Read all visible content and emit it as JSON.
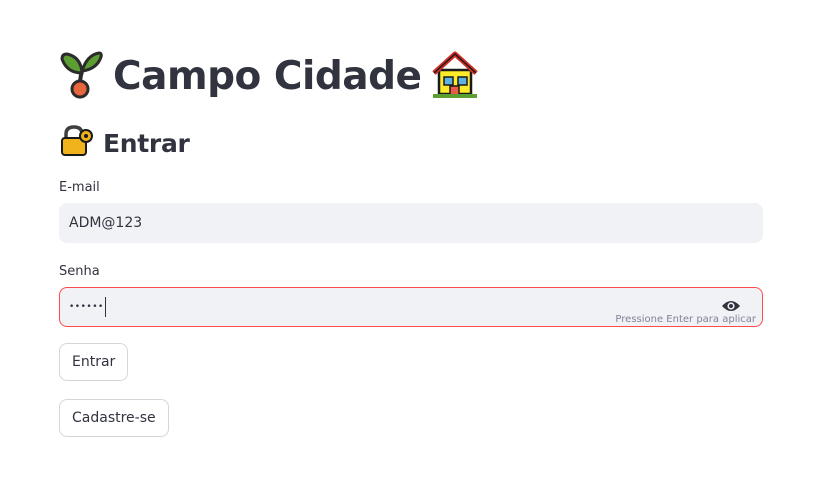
{
  "header": {
    "title": "Campo Cidade",
    "title_left_icon": "seedling-icon",
    "title_right_icon": "house-icon"
  },
  "section": {
    "title": "Entrar",
    "icon": "lock-with-key-icon"
  },
  "email": {
    "label": "E-mail",
    "value": "ADM@123"
  },
  "password": {
    "label": "Senha",
    "value": "••••••",
    "hint": "Pressione Enter para aplicar",
    "toggle_icon": "eye-icon"
  },
  "buttons": {
    "login_label": "Entrar",
    "signup_label": "Cadastre-se"
  },
  "colors": {
    "text": "#31333f",
    "input_bg": "#f0f2f6",
    "focus_border": "#ff4b4b",
    "button_border": "#d6d6d9"
  }
}
